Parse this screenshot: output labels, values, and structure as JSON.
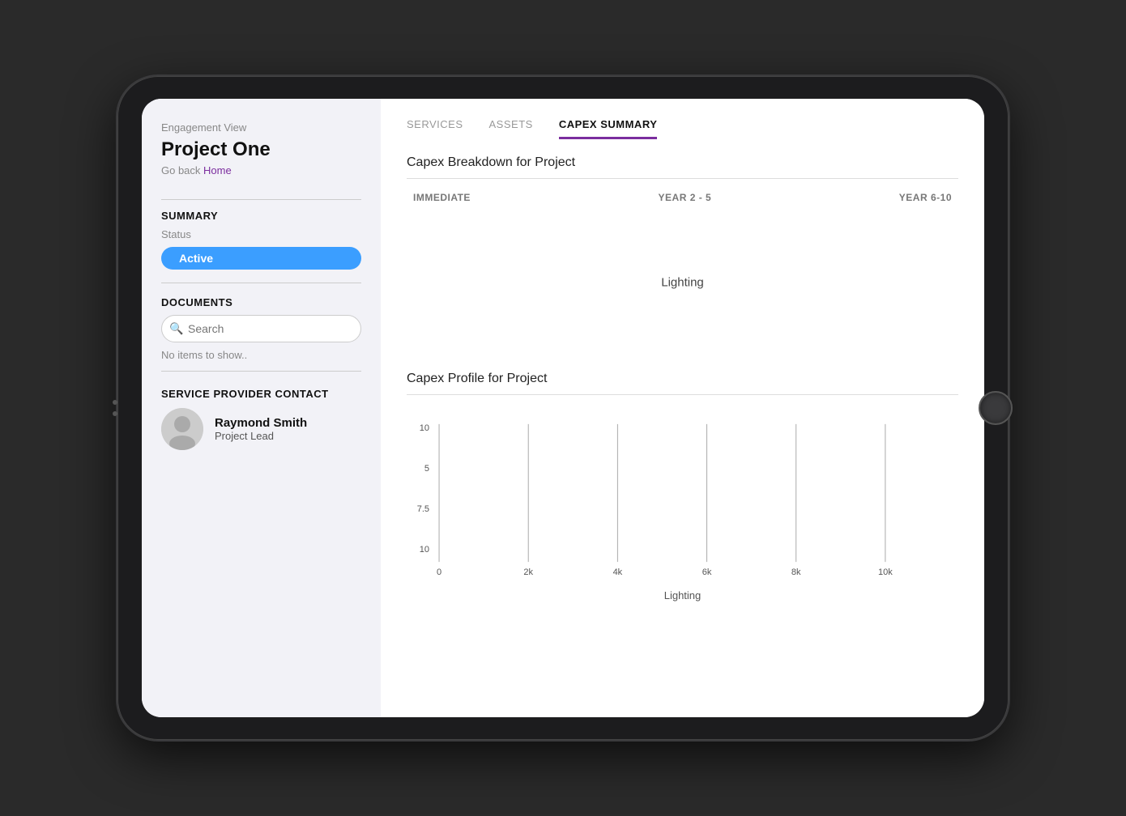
{
  "tablet": {
    "background": "#1c1c1e"
  },
  "sidebar": {
    "engagement_view": "Engagement View",
    "project_title": "Project One",
    "go_back_text": "Go back",
    "home_link": "Home",
    "summary_title": "SUMMARY",
    "status_label": "Status",
    "status_value": "Active",
    "documents_title": "DOCUMENTS",
    "search_placeholder": "Search",
    "no_items_text": "No items to show..",
    "service_provider_title": "SERVICE PROVIDER CONTACT",
    "contact_name": "Raymond Smith",
    "contact_role": "Project Lead"
  },
  "tabs": [
    {
      "label": "SERVICES",
      "active": false
    },
    {
      "label": "ASSETS",
      "active": false
    },
    {
      "label": "CAPEX SUMMARY",
      "active": true
    }
  ],
  "main": {
    "capex_breakdown_title": "Capex Breakdown for Project",
    "capex_col_immediate": "IMMEDIATE",
    "capex_col_year2_5": "YEAR 2 - 5",
    "capex_col_year6_10": "YEAR 6-10",
    "lighting_label": "Lighting",
    "capex_profile_title": "Capex Profile for Project",
    "chart_x_axis_label": "Lighting",
    "chart_y_labels": [
      "10",
      "5",
      "7.5",
      "10"
    ],
    "chart_x_labels": [
      "0",
      "2k",
      "4k",
      "6k",
      "8k",
      "10k"
    ]
  }
}
